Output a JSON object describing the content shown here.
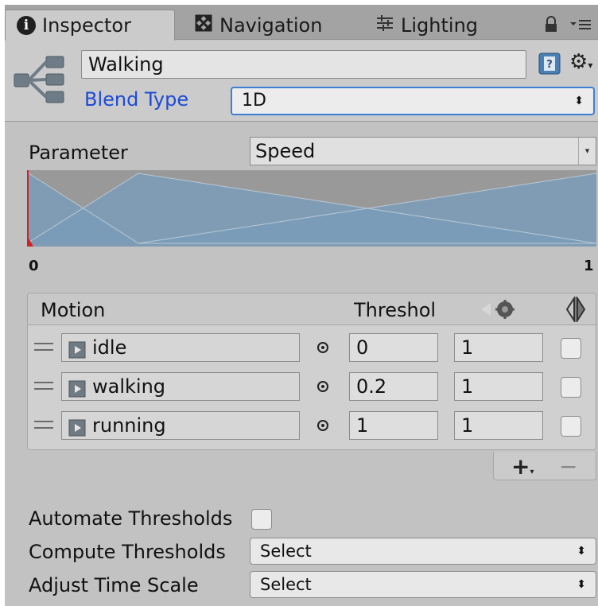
{
  "tabs": [
    {
      "label": "Inspector",
      "icon": "info-icon",
      "active": true
    },
    {
      "label": "Navigation",
      "icon": "navigation-icon",
      "active": false
    },
    {
      "label": "Lighting",
      "icon": "lighting-icon",
      "active": false
    }
  ],
  "header": {
    "name": "Walking",
    "blend_type_label": "Blend Type",
    "blend_type_value": "1D"
  },
  "parameter": {
    "label": "Parameter",
    "value": "Speed",
    "min_label": "0",
    "max_label": "1"
  },
  "motion_list": {
    "col_motion": "Motion",
    "col_threshold": "Threshold",
    "rows": [
      {
        "clip": "idle",
        "threshold": "0",
        "speed": "1"
      },
      {
        "clip": "walking",
        "threshold": "0.2",
        "speed": "1"
      },
      {
        "clip": "running",
        "threshold": "1",
        "speed": "1"
      }
    ]
  },
  "footer": {
    "add_label": "+",
    "remove_label": "−",
    "automate_label": "Automate Thresholds",
    "compute_label": "Compute Thresholds",
    "compute_value": "Select",
    "adjust_label": "Adjust Time Scale",
    "adjust_value": "Select"
  },
  "colors": {
    "panel": "#c2c2c2",
    "blend_label": "#1c4bd4",
    "graph_fill": "#7a9cb8",
    "graph_bg": "#999999",
    "marker": "#d42020"
  }
}
